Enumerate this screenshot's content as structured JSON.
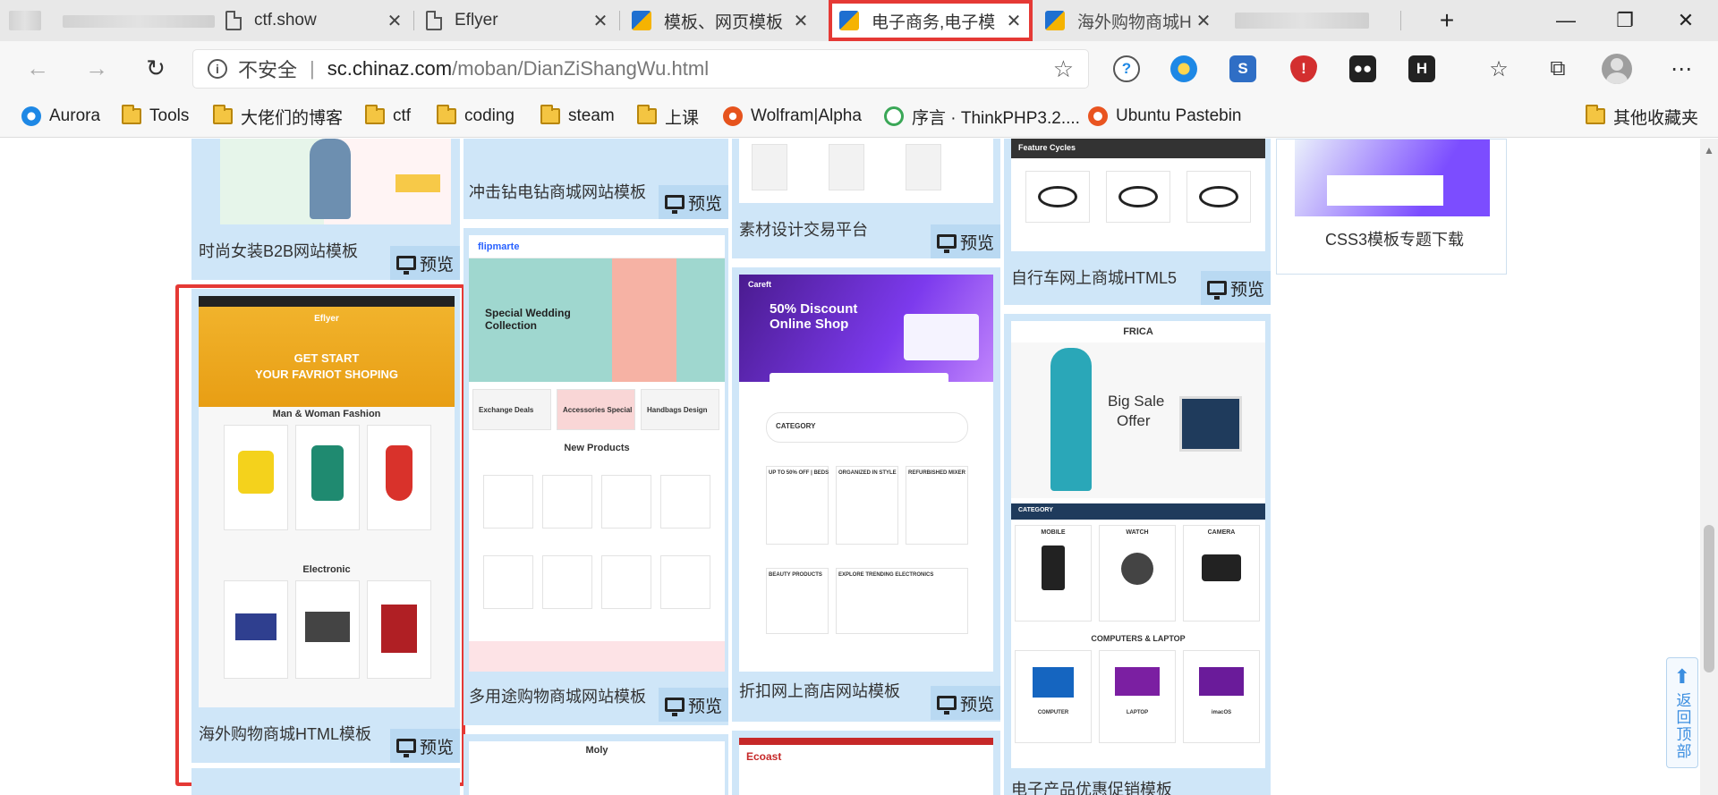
{
  "browser": {
    "tabs": [
      {
        "title": "ctf.show",
        "icon": "page-icon",
        "active": false
      },
      {
        "title": "Eflyer",
        "icon": "page-icon",
        "active": false
      },
      {
        "title": "模板、网页模板",
        "icon": "chinaz-icon",
        "active": false
      },
      {
        "title": "电子商务,电子模",
        "icon": "chinaz-icon",
        "active": true
      },
      {
        "title": "海外购物商城H",
        "icon": "chinaz-icon",
        "active": false
      }
    ],
    "new_tab": "+",
    "window_controls": {
      "minimize": "—",
      "restore": "❐",
      "close": "✕"
    },
    "address": {
      "security_label": "不安全",
      "host": "sc.chinaz.com",
      "path": "/moban/DianZiShangWu.html"
    },
    "extensions": [
      "password-manager-icon",
      "vpn-globe-icon",
      "s-extension-icon",
      "adblock-icon",
      "tampermonkey-icon",
      "h-extension-icon"
    ],
    "bookmarks": [
      {
        "label": "Aurora",
        "icon": "aurora-icon"
      },
      {
        "label": "Tools",
        "icon": "folder-icon"
      },
      {
        "label": "大佬们的博客",
        "icon": "folder-icon"
      },
      {
        "label": "ctf",
        "icon": "folder-icon"
      },
      {
        "label": "coding",
        "icon": "folder-icon"
      },
      {
        "label": "steam",
        "icon": "folder-icon"
      },
      {
        "label": "上课",
        "icon": "folder-icon"
      },
      {
        "label": "Wolfram|Alpha",
        "icon": "wolfram-icon"
      },
      {
        "label": "序言 · ThinkPHP3.2....",
        "icon": "thinkphp-icon"
      },
      {
        "label": "Ubuntu Pastebin",
        "icon": "ubuntu-icon"
      }
    ],
    "other_bookmarks": "其他收藏夹"
  },
  "page": {
    "preview_label": "预览",
    "cards": {
      "c1": {
        "label": "时尚女装B2B网站模板"
      },
      "c2": {
        "label": "海外购物商城HTML模板",
        "shot": {
          "hero_line1": "GET START",
          "hero_line2": "YOUR FAVRIOT SHOPING",
          "brand": "Eflyer",
          "section1": "Man & Woman Fashion",
          "section2": "Electronic"
        }
      },
      "c3": {
        "label": "冲击钻电钻商城网站模板"
      },
      "c4": {
        "label": "多用途购物商城网站模板",
        "shot": {
          "brand": "flipmarte",
          "hero": "Special Wedding Collection",
          "section": "New Products",
          "tiles": [
            "Exchange Deals",
            "Accessories Special",
            "Handbags Design"
          ]
        }
      },
      "c5": {
        "label": "素材设计交易平台"
      },
      "c6": {
        "label": "折扣网上商店网站模板",
        "shot": {
          "brand": "Careft",
          "hero": "50% Discount Online Shop",
          "category": "CATEGORY",
          "sub1": "UP TO 50% OFF | BEDS",
          "sub2": "ORGANIZED IN STYLE",
          "sub3": "REFURBISHED MIXER",
          "sub4": "BEAUTY PRODUCTS",
          "sub5": "EXPLORE TRENDING ELECTRONICS"
        }
      },
      "c7": {
        "label": "自行车网上商城HTML5",
        "shot": {
          "heading": "Feature Cycles"
        }
      },
      "c8": {
        "label": "电子产品优惠促销模板",
        "shot": {
          "brand": "FRICA",
          "hero_line1": "Big Sale",
          "hero_line2": "Offer",
          "bar": "CATEGORY",
          "p1": "MOBILE",
          "p2": "WATCH",
          "p3": "CAMERA",
          "section": "COMPUTERS & LAPTOP",
          "c1": "COMPUTER",
          "c2": "LAPTOP",
          "c3": "imacOS"
        }
      },
      "c9": {
        "label": "CSS3模板专题下载"
      },
      "c10": {
        "label": "Moly"
      },
      "c11": {
        "label": "Ecoast"
      }
    },
    "back_to_top": "返回顶部"
  },
  "colors": {
    "card_bg": "#cfe6f8",
    "highlight": "#e53935",
    "accent": "#3b8ee0"
  }
}
